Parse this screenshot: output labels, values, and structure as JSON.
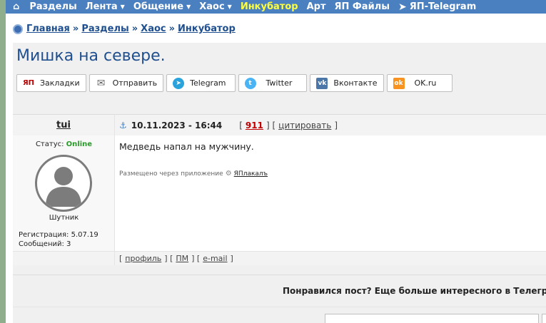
{
  "nav": {
    "items": [
      {
        "label": "Разделы",
        "caret": false,
        "active": false
      },
      {
        "label": "Лента",
        "caret": true,
        "active": false
      },
      {
        "label": "Общение",
        "caret": true,
        "active": false
      },
      {
        "label": "Хаос",
        "caret": true,
        "active": false
      },
      {
        "label": "Инкубатор",
        "caret": false,
        "active": true
      },
      {
        "label": "Арт",
        "caret": false,
        "active": false
      },
      {
        "label": "ЯП Файлы",
        "caret": false,
        "active": false
      },
      {
        "label": "ЯП-Telegram",
        "caret": false,
        "active": false
      }
    ]
  },
  "breadcrumb": {
    "items": [
      "Главная",
      "Разделы",
      "Хаос",
      "Инкубатор"
    ],
    "separator": "»"
  },
  "topic": {
    "title": "Мишка на севере."
  },
  "share": {
    "bookmarks": "Закладки",
    "send": "Отправить",
    "telegram": "Telegram",
    "twitter": "Twitter",
    "vk": "Вконтакте",
    "ok": "OK.ru",
    "icon_text": {
      "bookmarks": "ЯП",
      "vk": "vk",
      "ok": "ok"
    }
  },
  "post": {
    "author": "tui",
    "date": "10.11.2023 - 16:44",
    "number": "911",
    "quote_label": "цитировать",
    "status_label": "Статус:",
    "status_value": "Online",
    "rank": "Шутник",
    "registration": "Регистрация: 5.07.19",
    "messages": "Сообщений: 3",
    "message": "Медведь напал на мужчину.",
    "via_label": "Размещено через приложение",
    "via_app": "ЯПлакалъ",
    "links": {
      "profile": "профиль",
      "pm": "ПМ",
      "email": "e-mail"
    }
  },
  "promo": {
    "text": "Понравился пост? Еще больше интересного в Телеграм"
  },
  "colors": {
    "nav_bg": "#4a7fc0",
    "nav_active": "#ffff3c",
    "link": "#1f4f8f",
    "online": "#2a9a2a",
    "post_number": "#c00000"
  }
}
